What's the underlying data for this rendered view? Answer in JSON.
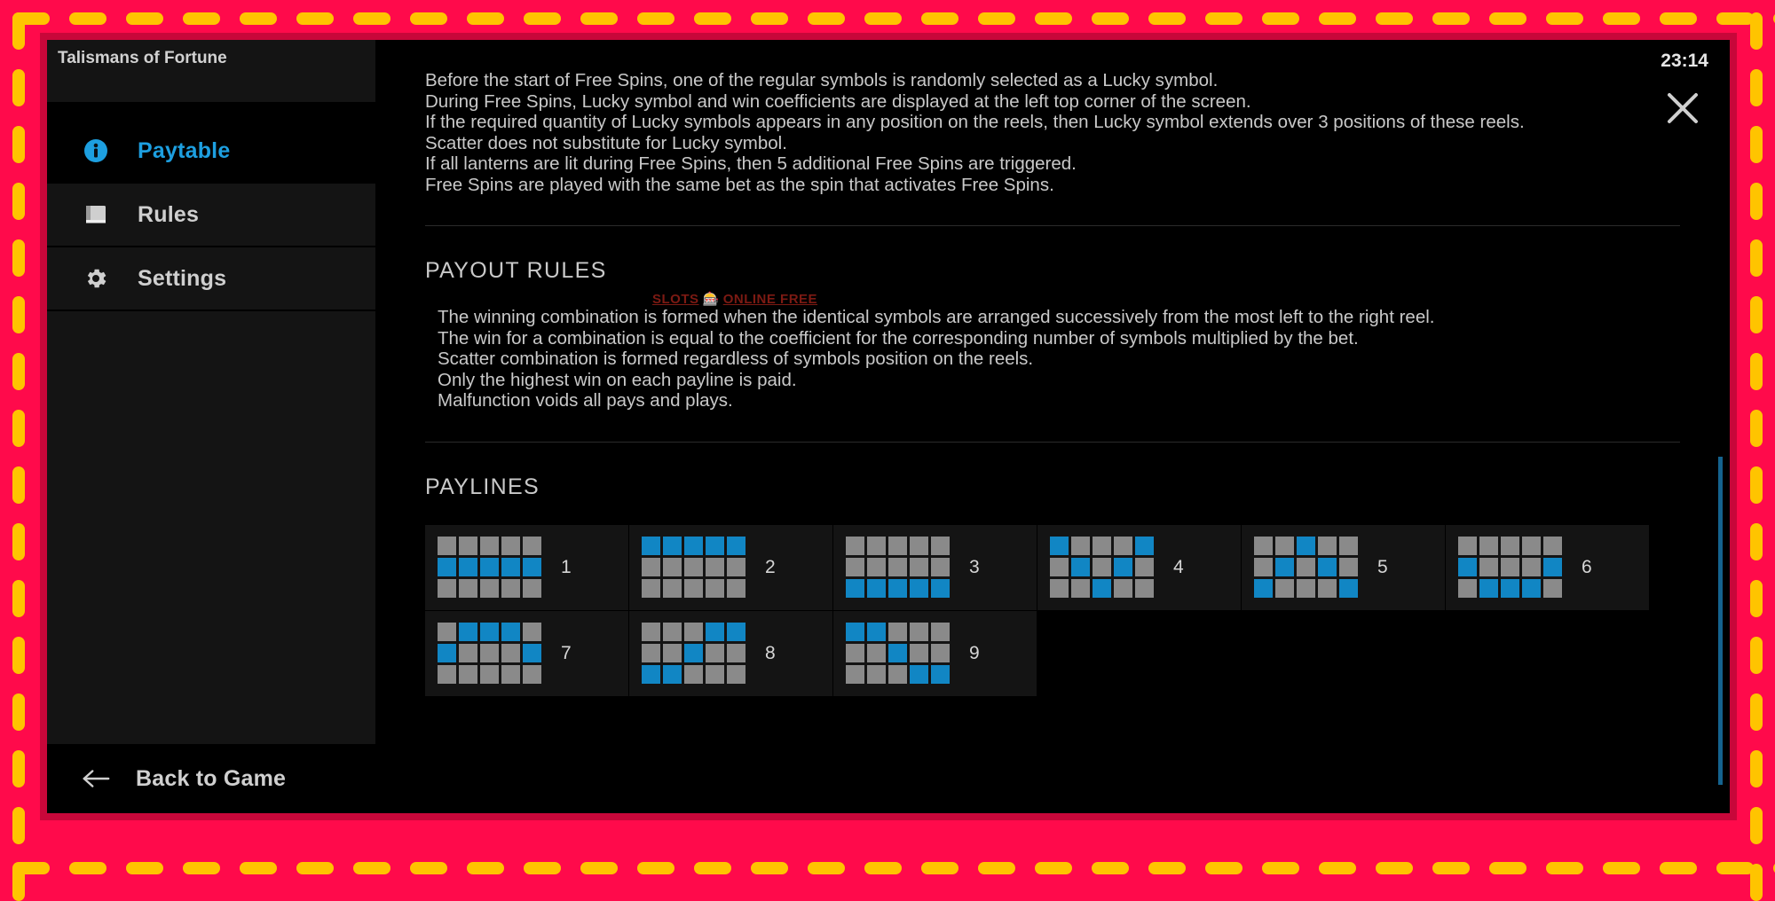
{
  "frame": {
    "border_color": "#ff0a4b",
    "dash_color": "#ffc400"
  },
  "window": {
    "game_title": "Talismans of Fortune",
    "clock": "23:14",
    "close_icon": "close-x-icon"
  },
  "sidebar": {
    "items": [
      {
        "label": "Paytable",
        "icon": "info-circle-icon",
        "active": true
      },
      {
        "label": "Rules",
        "icon": "book-icon",
        "active": false
      },
      {
        "label": "Settings",
        "icon": "gear-icon",
        "active": false
      }
    ],
    "back": {
      "label": "Back to Game",
      "icon": "arrow-left-icon"
    }
  },
  "content": {
    "intro_lines": [
      "Before the start of Free Spins, one of the regular symbols is randomly selected as a Lucky symbol.",
      "During Free Spins, Lucky symbol and win coefficients are displayed at the left top corner of the screen.",
      "If the required quantity of Lucky symbols appears in any position on the reels, then Lucky symbol extends over 3 positions of these reels.",
      "Scatter does not substitute for Lucky symbol.",
      "If all lanterns are lit during Free Spins, then 5 additional Free Spins are triggered.",
      "Free Spins are played with the same bet as the spin that activates Free Spins."
    ],
    "payout_rules_title": "PAYOUT RULES",
    "payout_rules_lines": [
      "The winning combination is formed when the identical symbols are arranged successively from the most left to the right reel.",
      "The win for a combination is equal to the coefficient for the corresponding number of symbols multiplied by the bet.",
      "Scatter combination is formed regardless of symbols position on the reels.",
      "Only the highest win on each payline is paid.",
      "Malfunction voids all pays and plays."
    ],
    "paylines_title": "PAYLINES",
    "paylines": [
      {
        "number": "1",
        "cells": [
          0,
          0,
          0,
          0,
          0,
          1,
          1,
          1,
          1,
          1,
          0,
          0,
          0,
          0,
          0
        ]
      },
      {
        "number": "2",
        "cells": [
          1,
          1,
          1,
          1,
          1,
          0,
          0,
          0,
          0,
          0,
          0,
          0,
          0,
          0,
          0
        ]
      },
      {
        "number": "3",
        "cells": [
          0,
          0,
          0,
          0,
          0,
          0,
          0,
          0,
          0,
          0,
          1,
          1,
          1,
          1,
          1
        ]
      },
      {
        "number": "4",
        "cells": [
          1,
          0,
          0,
          0,
          1,
          0,
          1,
          0,
          1,
          0,
          0,
          0,
          1,
          0,
          0
        ]
      },
      {
        "number": "5",
        "cells": [
          0,
          0,
          1,
          0,
          0,
          0,
          1,
          0,
          1,
          0,
          1,
          0,
          0,
          0,
          1
        ]
      },
      {
        "number": "6",
        "cells": [
          0,
          0,
          0,
          0,
          0,
          1,
          0,
          0,
          0,
          1,
          0,
          1,
          1,
          1,
          0
        ]
      },
      {
        "number": "7",
        "cells": [
          0,
          1,
          1,
          1,
          0,
          1,
          0,
          0,
          0,
          1,
          0,
          0,
          0,
          0,
          0
        ]
      },
      {
        "number": "8",
        "cells": [
          0,
          0,
          0,
          1,
          1,
          0,
          0,
          1,
          0,
          0,
          1,
          1,
          0,
          0,
          0
        ]
      },
      {
        "number": "9",
        "cells": [
          1,
          1,
          0,
          0,
          0,
          0,
          0,
          1,
          0,
          0,
          0,
          0,
          0,
          1,
          1
        ]
      }
    ],
    "watermark": {
      "left": "SLOTS",
      "icon": "slot-machine-icon",
      "right": "ONLINE FREE"
    }
  },
  "colors": {
    "accent_blue": "#1d9fe0",
    "tile_on": "#1186c4",
    "tile_off": "#8a8a8a",
    "text": "#c9c9c9",
    "scrollbar": "#15638f"
  }
}
